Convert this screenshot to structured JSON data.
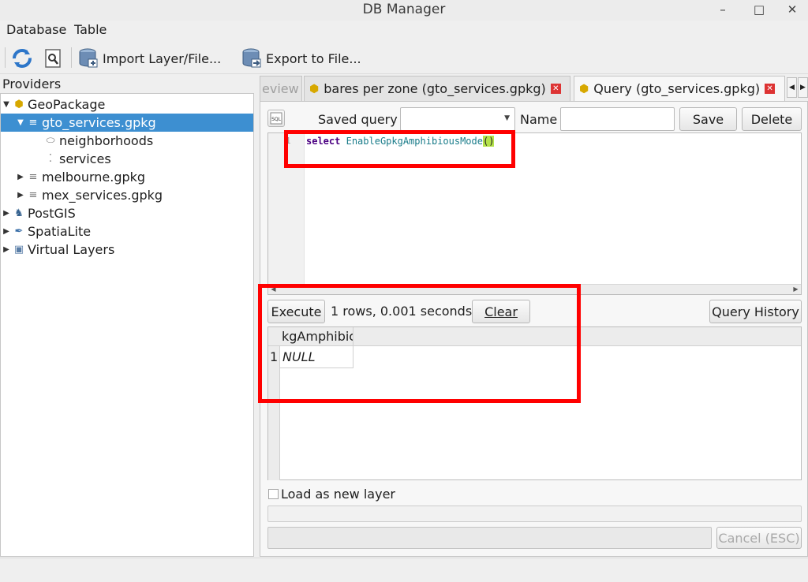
{
  "window": {
    "title": "DB Manager"
  },
  "menu": {
    "database": "Database",
    "table": "Table"
  },
  "toolbar": {
    "import_label": "Import Layer/File...",
    "export_label": "Export to File..."
  },
  "providers": {
    "label": "Providers",
    "items": [
      {
        "label": "GeoPackage",
        "icon": "geopackage-icon"
      },
      {
        "label": "gto_services.gpkg",
        "icon": "database-icon"
      },
      {
        "label": "neighborhoods",
        "icon": "polygon-layer-icon"
      },
      {
        "label": "services",
        "icon": "point-layer-icon"
      },
      {
        "label": "melbourne.gpkg",
        "icon": "database-icon"
      },
      {
        "label": "mex_services.gpkg",
        "icon": "database-icon"
      },
      {
        "label": "PostGIS",
        "icon": "postgis-elephant-icon"
      },
      {
        "label": "SpatiaLite",
        "icon": "spatialite-feather-icon"
      },
      {
        "label": "Virtual Layers",
        "icon": "virtual-layer-icon"
      }
    ]
  },
  "tabs": [
    {
      "label": "eview"
    },
    {
      "label": "bares per zone (gto_services.gpkg)"
    },
    {
      "label": "Query (gto_services.gpkg)"
    }
  ],
  "query": {
    "saved_query_label": "Saved query",
    "saved_query_value": "",
    "name_label": "Name",
    "name_value": "",
    "save_label": "Save",
    "delete_label": "Delete",
    "line_number": "1",
    "sql_keyword": "select",
    "sql_function": "EnableGpkgAmphibiousMode",
    "sql_parens": "()"
  },
  "execution": {
    "execute_label": "Execute",
    "status": "1 rows, 0.001 seconds",
    "clear_label": "Clear",
    "history_label": "Query History"
  },
  "results": {
    "columns": [
      "kgAmphibic"
    ],
    "rows": [
      {
        "num": "1",
        "cells": [
          "NULL"
        ]
      }
    ]
  },
  "options": {
    "load_as_layer_label": "Load as new layer",
    "cancel_label": "Cancel (ESC)"
  },
  "colors": {
    "selection": "#3d8fd1",
    "highlight": "#ff0000",
    "keyword": "#4b0082",
    "function": "#1a7c8a",
    "paren_match": "#b4e24a"
  }
}
